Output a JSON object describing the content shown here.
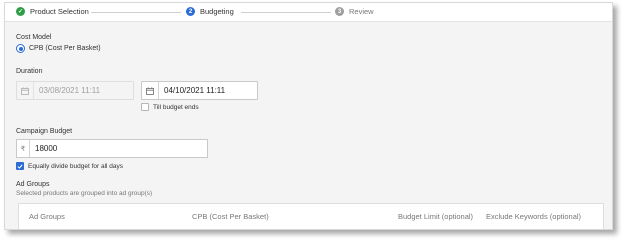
{
  "stepper": {
    "steps": [
      {
        "number": "✓",
        "label": "Product Selection",
        "state": "done",
        "color": "#2e9e46"
      },
      {
        "number": "2",
        "label": "Budgeting",
        "state": "active",
        "color": "#2b6cd6"
      },
      {
        "number": "3",
        "label": "Review",
        "state": "pending",
        "color": "#9e9e9e"
      }
    ]
  },
  "cost_model": {
    "label": "Cost Model",
    "option_label": "CPB (Cost Per Basket)",
    "selected": true
  },
  "duration": {
    "label": "Duration",
    "start_date": "03/08/2021 11:11",
    "start_disabled": true,
    "end_date": "04/10/2021 11:11",
    "till_budget_ends_label": "Till budget ends",
    "till_budget_ends_checked": false
  },
  "campaign_budget": {
    "label": "Campaign Budget",
    "currency_symbol": "₹",
    "value": "18000",
    "equally_divide_label": "Equally divide budget for all days",
    "equally_divide_checked": true
  },
  "ad_groups": {
    "title": "Ad Groups",
    "subtitle": "Selected products are grouped into ad group(s)",
    "columns": [
      "Ad Groups",
      "CPB (Cost Per Basket)",
      "Budget Limit (optional)",
      "Exclude Keywords (optional)"
    ]
  },
  "colors": {
    "accent": "#2b6cd6",
    "success": "#2e9e46",
    "pending": "#9e9e9e"
  }
}
